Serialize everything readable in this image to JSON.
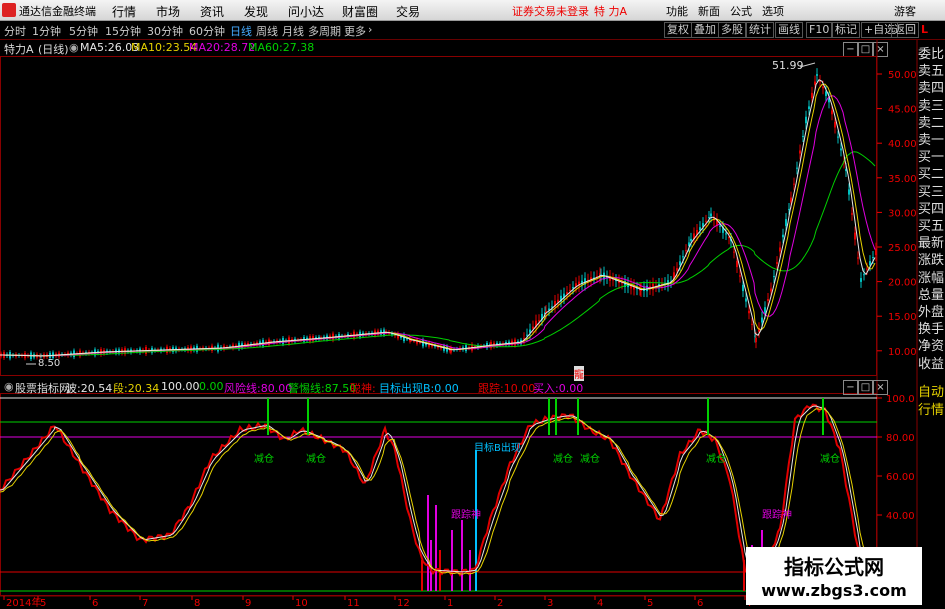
{
  "titlebar": {
    "app_name": "通达信金融终端",
    "menus": [
      "行情",
      "市场",
      "资讯",
      "发现",
      "问小达",
      "财富圈",
      "交易"
    ],
    "status": "证券交易未登录",
    "stock": "特 力A",
    "right_menus": [
      "功能",
      "新面",
      "公式",
      "选项"
    ],
    "user": "游客"
  },
  "toolbar": {
    "periods": [
      "分时",
      "1分钟",
      "5分钟",
      "15分钟",
      "30分钟",
      "60分钟",
      "日线",
      "周线",
      "月线",
      "多周期",
      "更多"
    ],
    "active_period": "日线",
    "right_buttons": [
      "复权",
      "叠加",
      "多股",
      "统计",
      "画线",
      "F10",
      "标记"
    ],
    "self_select": "+自选",
    "back_btn": "返回",
    "side_label": "L"
  },
  "main": {
    "title": "特力A",
    "period": "(日线)",
    "ma": [
      {
        "label": "MA5:",
        "value": "26.03",
        "color": "#e6e6e6"
      },
      {
        "label": "MA10:",
        "value": "23.54",
        "color": "#e6d200"
      },
      {
        "label": "MA20:",
        "value": "28.72",
        "color": "#e000e0"
      },
      {
        "label": "MA60:",
        "value": "27.38",
        "color": "#00d000"
      }
    ],
    "annotations": {
      "high": "51.99",
      "low": "8.50",
      "mark": "寵"
    }
  },
  "sidebar": {
    "items": [
      "委比",
      "卖五",
      "卖四",
      "卖三",
      "卖二",
      "卖一",
      "买一",
      "买二",
      "买三",
      "买四",
      "买五",
      "最新",
      "涨跌",
      "涨幅",
      "总量",
      "外盘",
      "换手",
      "净资",
      "收益"
    ],
    "items2": [
      "自动",
      "行情"
    ]
  },
  "indicator": {
    "name": "股票指标网",
    "items": [
      {
        "label": "波:",
        "value": "20.54",
        "color": "#e6e6e6"
      },
      {
        "label": "段:",
        "value": "20.34",
        "color": "#e6d200"
      },
      {
        "label": "",
        "value": "100.00",
        "color": "#e6e6e6"
      },
      {
        "label": "",
        "value": "0.00",
        "color": "#00d000"
      },
      {
        "label": "风险线:",
        "value": "80.00",
        "color": "#e000e0"
      },
      {
        "label": "警惕线:",
        "value": "87.50",
        "color": "#00d000"
      },
      {
        "label": "聪神:",
        "value": "",
        "color": "#e00000"
      },
      {
        "label": "目标出现B:",
        "value": "0.00",
        "color": "#00c0ff"
      },
      {
        "label": "跟踪:",
        "value": "10.00",
        "color": "#e00000"
      },
      {
        "label": "买入:",
        "value": "0.00",
        "color": "#e000e0"
      }
    ],
    "labels": {
      "reduce": "减仓",
      "follow": "跟踪神",
      "target": "目标B出现"
    }
  },
  "axes": {
    "price_ticks": [
      "50.00",
      "45.00",
      "40.00",
      "35.00",
      "30.00",
      "25.00",
      "20.00",
      "15.00",
      "10.00"
    ],
    "ind_ticks": [
      "100.0",
      "80.00",
      "60.00",
      "40.00",
      "20.00"
    ],
    "date_ticks": [
      "2014年",
      "5",
      "6",
      "7",
      "8",
      "9",
      "10",
      "11",
      "12",
      "1",
      "2",
      "3",
      "4",
      "5",
      "6",
      "7"
    ]
  },
  "watermark": {
    "line1": "指标公式网",
    "line2": "www.zbgs3.com"
  },
  "colors": {
    "up": "#e00000",
    "ma5": "#e6e6e6",
    "ma10": "#e6d200",
    "ma20": "#e000e0",
    "ma60": "#00d000"
  }
}
